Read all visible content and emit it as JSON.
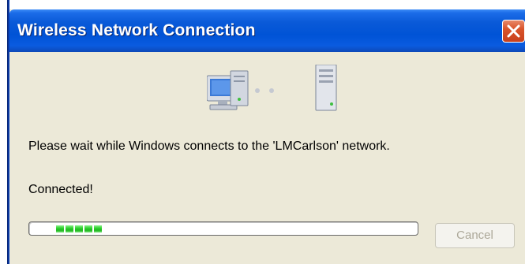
{
  "window": {
    "title": "Wireless Network Connection",
    "close_symbol": "✕"
  },
  "icons": [
    "computer-icon",
    "connecting-dots-icon",
    "network-server-icon"
  ],
  "content": {
    "message": "Please wait while Windows connects to the 'LMCarlson' network.",
    "status": "Connected!"
  },
  "progress": {
    "value_fraction": 0.2,
    "segments_filled": 5
  },
  "buttons": {
    "cancel_label": "Cancel",
    "cancel_enabled": false
  },
  "colors": {
    "titlebar": "#0053d6",
    "dialog_bg": "#ece9d8",
    "close": "#d9542a",
    "progress_fill": "#2ed12e",
    "disabled_text": "#aca899"
  }
}
